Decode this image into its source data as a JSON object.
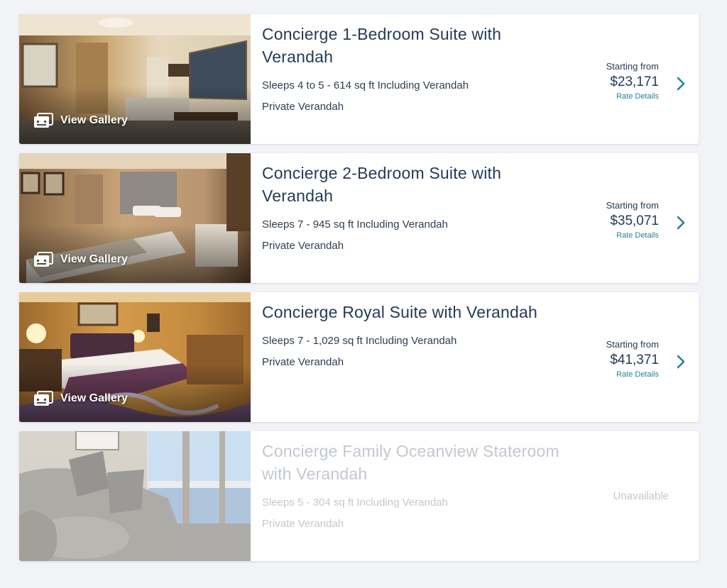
{
  "colors": {
    "background": "#f1f3f7",
    "title": "#253b56",
    "link": "#2a8196",
    "chevron": "#2a8196",
    "disabled_text": "#c3c8cf"
  },
  "gallery_label": "View Gallery",
  "staterooms": [
    {
      "title": "Concierge 1-Bedroom Suite with Verandah",
      "sleeps": "Sleeps 4 to 5 - 614 sq ft Including Verandah",
      "feature": "Private Verandah",
      "starting_label": "Starting from",
      "price": "$23,171",
      "rate_details": "Rate Details",
      "icon": "chevron-right-icon"
    },
    {
      "title": "Concierge 2-Bedroom Suite with Verandah",
      "sleeps": "Sleeps 7 - 945 sq ft Including Verandah",
      "feature": "Private Verandah",
      "starting_label": "Starting from",
      "price": "$35,071",
      "rate_details": "Rate Details",
      "icon": "chevron-right-icon"
    },
    {
      "title": "Concierge Royal Suite with Verandah",
      "sleeps": "Sleeps 7 - 1,029 sq ft Including Verandah",
      "feature": "Private Verandah",
      "starting_label": "Starting from",
      "price": "$41,371",
      "rate_details": "Rate Details",
      "icon": "chevron-right-icon"
    },
    {
      "title": "Concierge Family Oceanview Stateroom with Verandah",
      "sleeps": "Sleeps 5 - 304 sq ft Including Verandah",
      "feature": "Private Verandah",
      "status": "Unavailable"
    }
  ]
}
